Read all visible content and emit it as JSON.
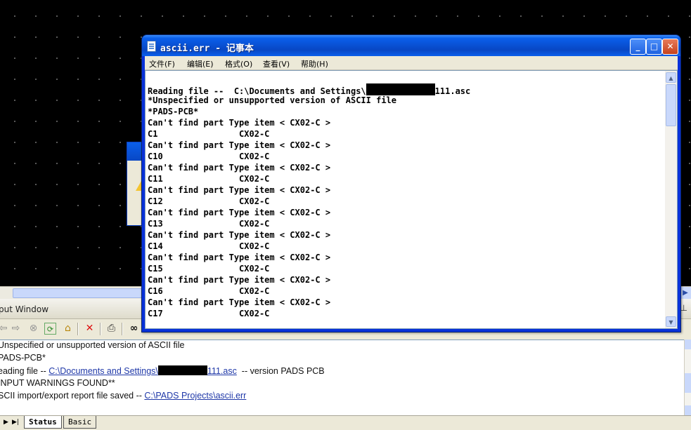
{
  "notepad": {
    "title": "ascii.err - 记事本",
    "menu": [
      "文件(F)",
      "编辑(E)",
      "格式(O)",
      "查看(V)",
      "帮助(H)"
    ],
    "buttons": {
      "minimize": "_",
      "maximize": "□",
      "close": "✕"
    },
    "lines": [
      {
        "pre": "Reading file --  C:\\Documents and Settings\\",
        "post": "111.asc"
      },
      {
        "text": "*Unspecified or unsupported version of ASCII file"
      },
      {
        "text": "*PADS-PCB*"
      },
      {
        "text": "Can't find part Type item < CX02-C >"
      },
      {
        "text": "C1                CX02-C"
      },
      {
        "text": "Can't find part Type item < CX02-C >"
      },
      {
        "text": "C10               CX02-C"
      },
      {
        "text": "Can't find part Type item < CX02-C >"
      },
      {
        "text": "C11               CX02-C"
      },
      {
        "text": "Can't find part Type item < CX02-C >"
      },
      {
        "text": "C12               CX02-C"
      },
      {
        "text": "Can't find part Type item < CX02-C >"
      },
      {
        "text": "C13               CX02-C"
      },
      {
        "text": "Can't find part Type item < CX02-C >"
      },
      {
        "text": "C14               CX02-C"
      },
      {
        "text": "Can't find part Type item < CX02-C >"
      },
      {
        "text": "C15               CX02-C"
      },
      {
        "text": "Can't find part Type item < CX02-C >"
      },
      {
        "text": "C16               CX02-C"
      },
      {
        "text": "Can't find part Type item < CX02-C >"
      },
      {
        "text": "C17               CX02-C"
      }
    ]
  },
  "output_window": {
    "title": "put Window",
    "lines": {
      "l1": "Unspecified or unsupported version of ASCII file",
      "l2": "PADS-PCB*",
      "l3_pre": "eading file -- ",
      "l3_link_a": "C:\\Documents and Settings\\",
      "l3_link_b": "111.asc",
      "l3_post": "  -- version PADS PCB",
      "l4": "INPUT WARNINGS FOUND**",
      "l5_pre": "SCII import/export report file saved -- ",
      "l5_link": "C:\\PADS Projects\\ascii.err"
    },
    "tabs": [
      "Status",
      "Basic"
    ],
    "toolbar_icons": [
      "back-icon",
      "forward-icon",
      "stop-icon",
      "refresh-icon",
      "home-icon",
      "delete-icon",
      "print-icon",
      "find-icon"
    ]
  }
}
